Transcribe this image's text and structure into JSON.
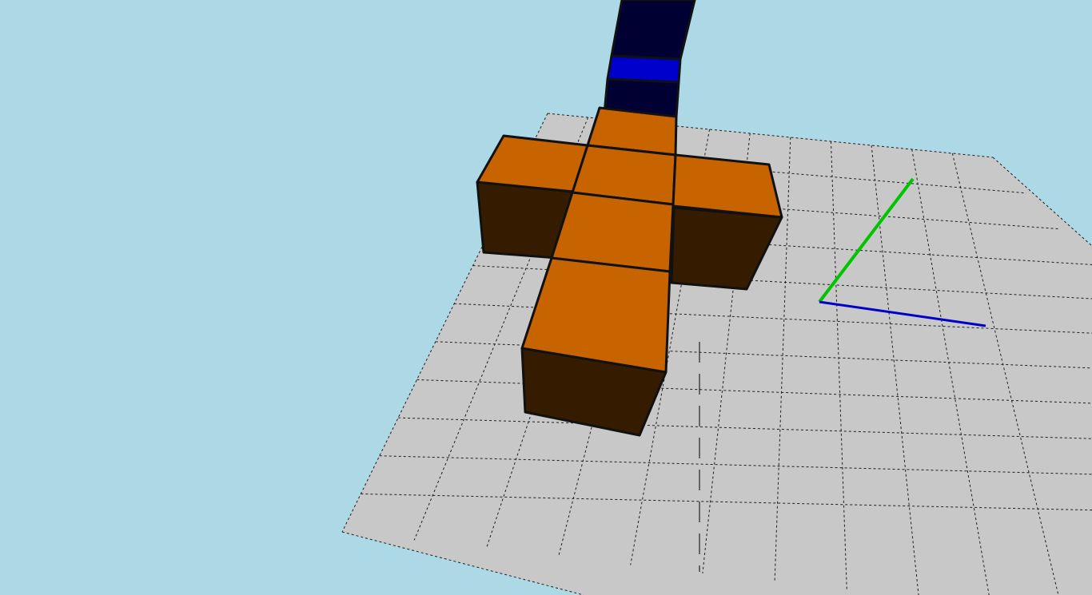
{
  "scene": {
    "background_color": "#add8e6",
    "ground": {
      "fill": "#c8c8c8",
      "grid_line_color": "#1e1e1e",
      "grid_style": "dashed"
    },
    "axes": {
      "green_axis_color": "#00c400",
      "blue_axis_color": "#0000c8",
      "vertical_marker_color": "#000000"
    },
    "cross_object": {
      "top_face_color": "#c86400",
      "side_face_color": "#351c00",
      "edge_color": "#111111",
      "cube_count": 5
    },
    "rod": {
      "dark_color": "#000033",
      "highlight_color": "#0000cc",
      "edge_color": "#111111"
    }
  }
}
